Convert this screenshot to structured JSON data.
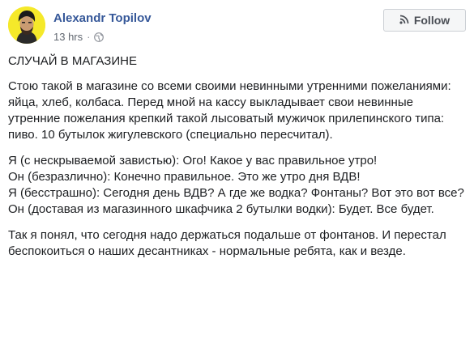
{
  "post": {
    "author": "Alexandr Topilov",
    "timestamp": "13 hrs",
    "separator": "·",
    "privacy_icon": "globe-icon",
    "follow_icon": "rss-icon",
    "follow_label": "Follow",
    "title": "СЛУЧАЙ В МАГАЗИНЕ",
    "paragraphs": [
      "Стою такой в магазине со всеми своими невинными утренними пожеланиями: яйца, хлеб, колбаса. Перед мной на кассу выкладывает свои невинные утренние пожелания крепкий такой лысоватый мужичок прилепинского типа: пиво. 10 бутылок жигулевского (специально пересчитал).",
      "Я (с нескрываемой завистью): Ого! Какое у вас правильное утро!",
      "Он (безразлично): Конечно правильное. Это же утро дня ВДВ!",
      "Я (бесстрашно): Сегодня день ВДВ? А где же водка? Фонтаны? Вот это вот все?",
      "Он (доставая из магазинного шкафчика 2 бутылки водки): Будет. Все будет.",
      "Так я понял, что сегодня надо держаться подальше от фонтанов. И перестал беспокоиться о наших десантниках - нормальные ребята, как и везде."
    ]
  },
  "colors": {
    "author_link": "#365899",
    "avatar_bg": "#f5e92a",
    "meta_text": "#616770",
    "button_bg": "#f5f6f7",
    "button_border": "#ccd0d5"
  }
}
